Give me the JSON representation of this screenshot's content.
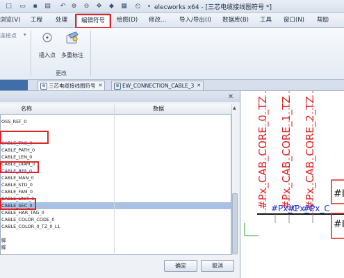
{
  "titlebar": {
    "title": "elecworks x64 - [三芯电缆接线图符号 *]",
    "qat_icons": [
      "new-icon",
      "open-icon",
      "save-icon",
      "zoom-in-icon",
      "zoom-out-icon",
      "pan-icon",
      "redraw-icon",
      "print-icon",
      "clock-icon",
      "dropdown-icon"
    ]
  },
  "menu": {
    "items": [
      "浏览(V)",
      "工程",
      "处理",
      "编辑符号",
      "绘图(D)",
      "修改...",
      "导入/导出(I)",
      "数据库(B)",
      "工具",
      "窗口(N)",
      "帮助"
    ],
    "active": "编辑符号"
  },
  "ribbon": {
    "left_label": "连接点",
    "buttons": [
      {
        "label": "插入点",
        "icon": "insert-point-icon"
      },
      {
        "label": "多重标注",
        "icon": "multi-annotation-icon"
      }
    ],
    "group_label": "更改"
  },
  "doc_tabs": [
    {
      "label": "三芯电缆接线图符号",
      "icon": "symbol-icon"
    },
    {
      "label": "EW_CONNECTION_CABLE_3",
      "icon": "symbol-icon"
    }
  ],
  "dialog": {
    "col_name": "名称",
    "col_data": "数据",
    "rows": [
      {
        "name": "OSS_REF_0",
        "style": ""
      },
      {
        "name": "",
        "style": ""
      },
      {
        "name": "",
        "style": ""
      },
      {
        "name": "CABLE_TAG_0",
        "style": "blue"
      },
      {
        "name": "CABLE_PATH_0",
        "style": ""
      },
      {
        "name": "CABLE_LEN_0",
        "style": ""
      },
      {
        "name": "CABLE_DIAM_0",
        "style": ""
      },
      {
        "name": "CABLE_REF_0",
        "style": "blue"
      },
      {
        "name": "CABLE_MAN_0",
        "style": ""
      },
      {
        "name": "CABLE_STD_0",
        "style": ""
      },
      {
        "name": "CABLE_FAM_0",
        "style": ""
      },
      {
        "name": "CABLE_UNIT_0",
        "style": ""
      },
      {
        "name": "CABLE_SEC_0",
        "style": "sel"
      },
      {
        "name": "CABLE_HAR_TAG_0",
        "style": ""
      },
      {
        "name": "CABLE_COLOR_CODE_0",
        "style": ""
      },
      {
        "name": "CABLE_COLOR_0_TZ_0_L1",
        "style": ""
      },
      {
        "name": "",
        "style": ""
      },
      {
        "name": "脚",
        "style": ""
      },
      {
        "name": "脚",
        "style": ""
      }
    ],
    "ok_label": "确定",
    "cancel_label": "取消"
  },
  "canvas": {
    "vertical_labels": [
      "#Px_CAB_CORE_0_TZ",
      "#Px_CAB_CORE_1_TZ",
      "#Px_CAB_CORE_2_TZ"
    ],
    "horizontal_labels": [
      "#Px_C",
      "#Px_C",
      "#Px_C"
    ],
    "edge_labels": [
      "#I",
      "#I"
    ]
  },
  "colors": {
    "highlight_red": "#e0262b",
    "selected_row": "#a9c1e4",
    "blue_text": "#2143c4",
    "canvas_red": "#e02424",
    "canvas_blue": "#1f2fd8"
  }
}
